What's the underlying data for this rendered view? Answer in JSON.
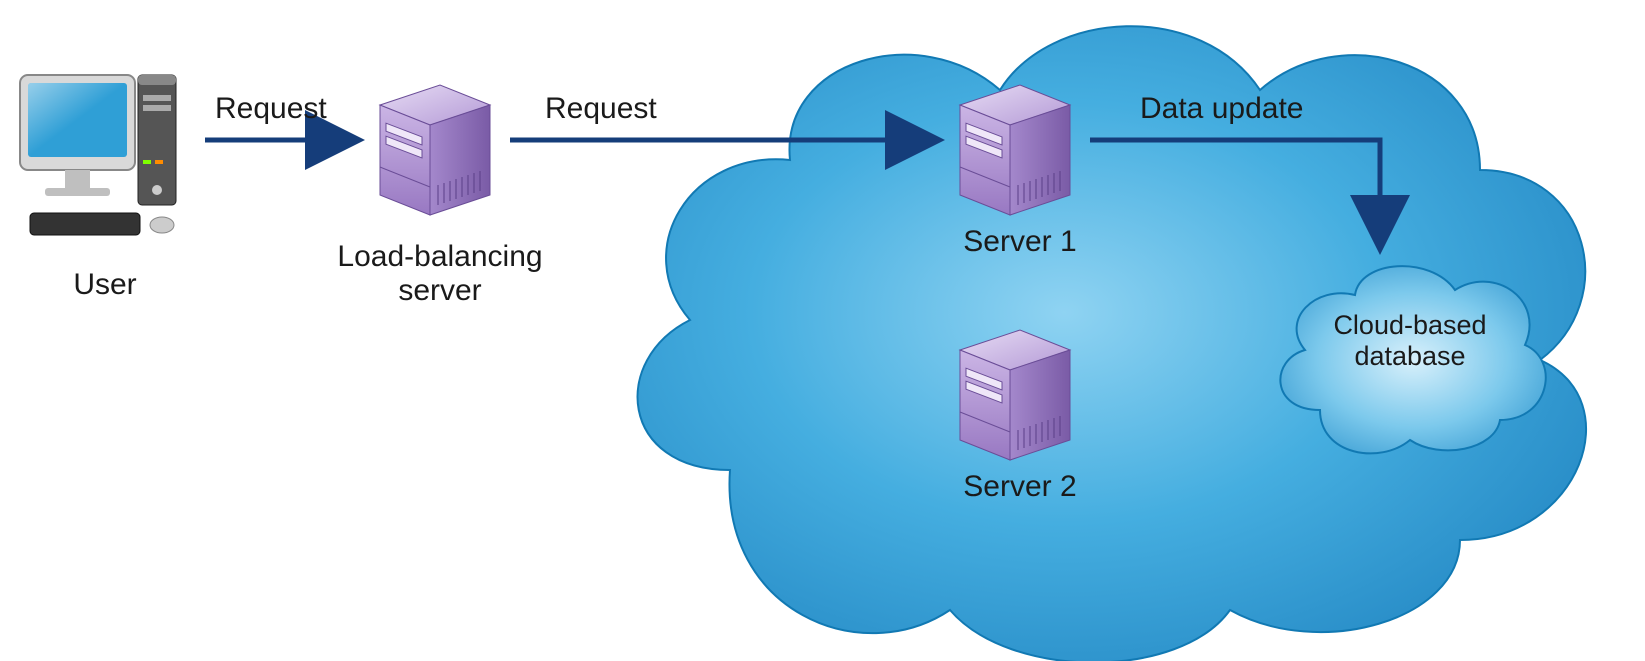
{
  "nodes": {
    "user": {
      "label": "User"
    },
    "lb": {
      "label": "Load-balancing\nserver"
    },
    "s1": {
      "label": "Server 1"
    },
    "s2": {
      "label": "Server 2"
    },
    "db": {
      "label": "Cloud-based\ndatabase"
    }
  },
  "edges": {
    "user_to_lb": {
      "label": "Request"
    },
    "lb_to_s1": {
      "label": "Request"
    },
    "s1_to_db": {
      "label": "Data update"
    }
  },
  "colors": {
    "arrow": "#153d7a",
    "cloud_fill_outer": "#2f9fd6",
    "cloud_fill_inner": "#5ab7e4",
    "cloud_stroke": "#0c6aa3",
    "server_light": "#d7c6ea",
    "server_dark": "#a083c4",
    "monitor_screen": "#2f9fd6"
  }
}
